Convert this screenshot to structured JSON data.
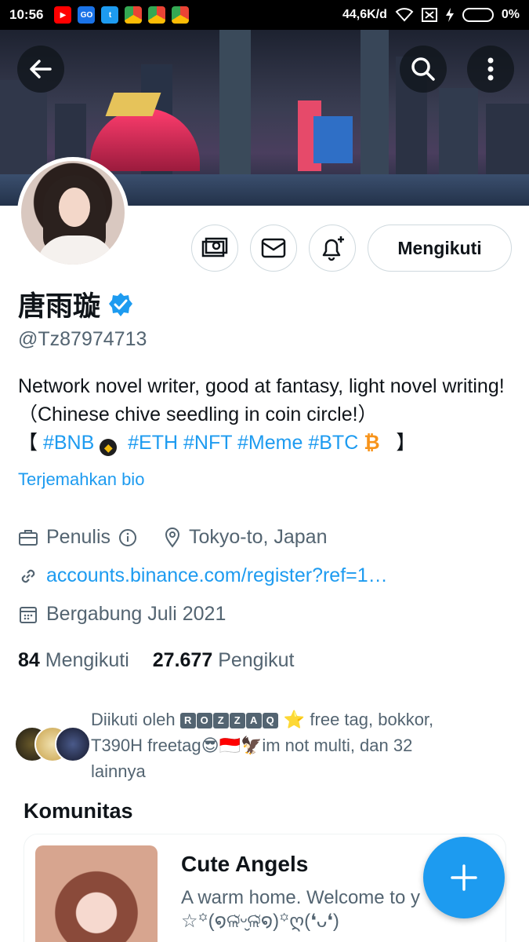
{
  "status_bar": {
    "time": "10:56",
    "network_speed": "44,6K/d",
    "battery": "0%",
    "apps": [
      {
        "icon": "youtube-icon",
        "color": "#ff0000"
      },
      {
        "icon": "go-icon",
        "color": "#1a73e8"
      },
      {
        "icon": "twitter-icon",
        "color": "#1d9bf0"
      },
      {
        "icon": "chrome-icon",
        "color": "#34a853"
      },
      {
        "icon": "chrome-icon",
        "color": "#34a853"
      },
      {
        "icon": "chrome-icon",
        "color": "#34a853"
      }
    ]
  },
  "header": {
    "back_icon": "arrow-left-icon",
    "search_icon": "search-icon",
    "more_icon": "more-vertical-icon"
  },
  "actions": {
    "tip_icon": "money-icon",
    "message_icon": "envelope-icon",
    "notify_icon": "bell-plus-icon",
    "follow_label": "Mengikuti"
  },
  "profile": {
    "name": "唐雨璇",
    "verified_icon": "verified-badge-icon",
    "handle": "@Tz87974713",
    "bio_line1": "Network novel writer, good at fantasy, light novel writing!（Chinese chive seedling in coin circle!）",
    "bio_open": "【",
    "tag_bnb": "#BNB",
    "tag_eth": "#ETH",
    "tag_nft": "#NFT",
    "tag_meme": "#Meme",
    "tag_btc": "#BTC",
    "btc_symbol": "₿",
    "bio_close": "】",
    "translate_bio": "Terjemahkan bio",
    "category": "Penulis",
    "location": "Tokyo-to, Japan",
    "website": "accounts.binance.com/register?ref=1…",
    "joined": "Bergabung Juli 2021",
    "following_count": "84",
    "following_label": "Mengikuti",
    "followers_count": "27.677",
    "followers_label": "Pengikut"
  },
  "followed_by": {
    "prefix": "Diikuti oleh",
    "badge_letters": [
      "R",
      "O",
      "Z",
      "Z",
      "A",
      "Q"
    ],
    "star": "⭐",
    "text1": "free tag, bokkor,",
    "text2": "T390H freetag😎🇮🇩🦅im not multi, dan 32",
    "text3": "lainnya"
  },
  "communities": {
    "title": "Komunitas",
    "items": [
      {
        "name": "Cute Angels",
        "description": "A warm home. Welcome to y\n☆꙳(໑ଳ̴̆ᵕ̮ଳ̴̆໑)꙳ღ(❛ᴗ❛)"
      }
    ]
  },
  "fab": {
    "icon": "plus-icon"
  },
  "colors": {
    "accent": "#1d9bf0",
    "text_primary": "#0f1419",
    "text_secondary": "#536471",
    "border": "#cfd9de"
  }
}
